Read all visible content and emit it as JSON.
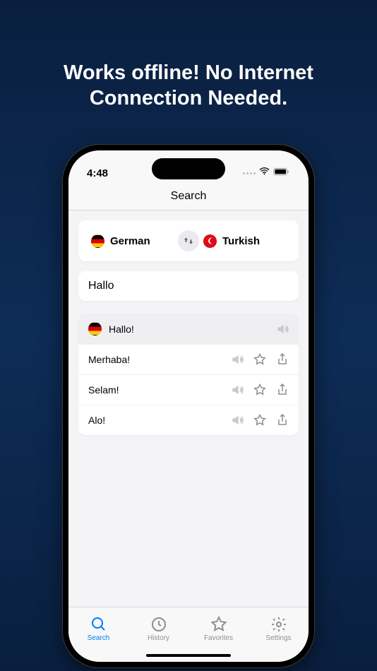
{
  "promo": {
    "title": "Works offline! No Internet Connection Needed."
  },
  "status": {
    "time": "4:48"
  },
  "nav": {
    "title": "Search"
  },
  "languages": {
    "source": "German",
    "target": "Turkish"
  },
  "search": {
    "query": "Hallo"
  },
  "results": {
    "header": "Hallo!",
    "items": [
      {
        "text": "Merhaba!"
      },
      {
        "text": "Selam!"
      },
      {
        "text": "Alo!"
      }
    ]
  },
  "tabs": {
    "search": "Search",
    "history": "History",
    "favorites": "Favorites",
    "settings": "Settings"
  }
}
